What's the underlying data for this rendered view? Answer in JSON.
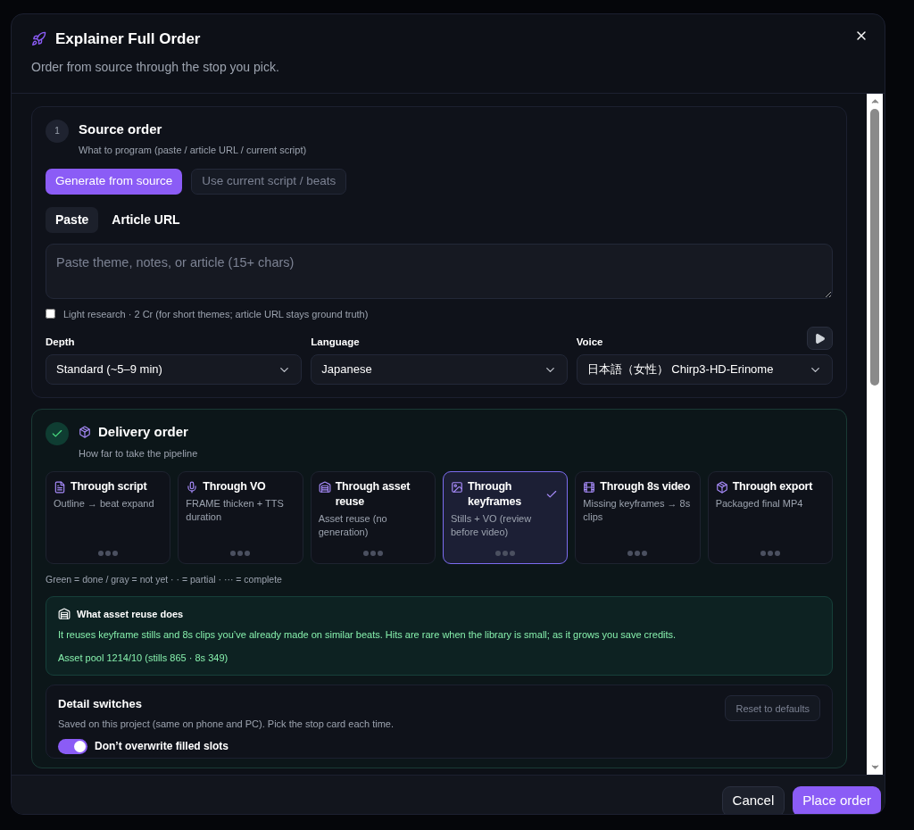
{
  "dialog": {
    "title": "Explainer Full Order",
    "subtitle": "Order from source through the stop you pick."
  },
  "source": {
    "step": "1",
    "done": false,
    "title": "Source order",
    "subtitle": "What to program (paste / article URL / current script)",
    "modes": [
      {
        "label": "Generate from source",
        "selected": true
      },
      {
        "label": "Use current script / beats",
        "selected": false
      }
    ],
    "tabs": [
      {
        "label": "Paste",
        "selected": true
      },
      {
        "label": "Article URL",
        "selected": false
      }
    ],
    "input": {
      "placeholder": "Paste theme, notes, or article (15+ chars)"
    },
    "research": {
      "label": "Light research · 2 Cr (for short themes; article URL stays ground truth)",
      "checked": false
    },
    "selects": [
      {
        "label": "Depth",
        "value": "Standard (~5–9 min)"
      },
      {
        "label": "Language",
        "value": "Japanese"
      },
      {
        "label": "Voice",
        "value": "日本語（女性） Chirp3-HD-Erinome",
        "play": true
      }
    ]
  },
  "delivery": {
    "done": true,
    "title": "Delivery order",
    "subtitle": "How far to take the pipeline",
    "stops": [
      {
        "kind": "script",
        "title": "Through script",
        "desc": "Outline → beat expand",
        "selected": false
      },
      {
        "kind": "vo",
        "title": "Through VO",
        "desc": "FRAME thicken + TTS duration",
        "selected": false
      },
      {
        "kind": "reuse",
        "title": "Through asset reuse",
        "desc": "Asset reuse (no generation)",
        "selected": false
      },
      {
        "kind": "keyframes",
        "title": "Through keyframes",
        "desc": "Stills + VO (review before video)",
        "selected": true
      },
      {
        "kind": "video",
        "title": "Through 8s video",
        "desc": "Missing keyframes → 8s clips",
        "selected": false
      },
      {
        "kind": "export",
        "title": "Through export",
        "desc": "Packaged final MP4",
        "selected": false
      }
    ],
    "legend": "Green = done / gray = not yet · · = partial · ··· = complete",
    "info": {
      "title": "What asset reuse does",
      "body": "It reuses keyframe stills and 8s clips you’ve already made on similar beats. Hits are rare when the library is small; as it grows you save credits.",
      "pool": "Asset pool 1214/10 (stills 865 · 8s 349)"
    }
  },
  "details": {
    "title": "Detail switches",
    "subtitle": "Saved on this project (same on phone and PC). Pick the stop card each time.",
    "reset": "Reset to defaults",
    "switches": [
      {
        "label": "Don’t overwrite filled slots",
        "on": true
      }
    ]
  },
  "footer": {
    "cancel": "Cancel",
    "submit": "Place order"
  }
}
